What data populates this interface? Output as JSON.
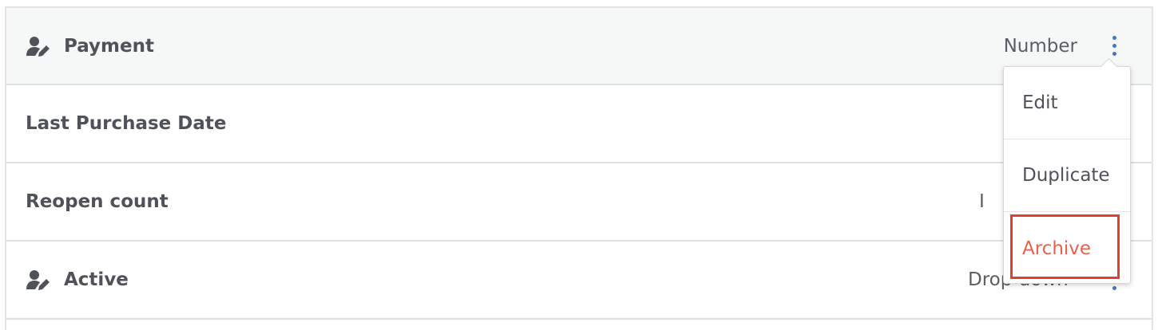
{
  "rows": [
    {
      "label": "Payment",
      "type": "Number",
      "icon": "user-edit-icon"
    },
    {
      "label": "Last Purchase Date",
      "type": ""
    },
    {
      "label": "Reopen count",
      "type": "I"
    },
    {
      "label": "Active",
      "type": "Drop-down",
      "icon": "user-edit-icon"
    }
  ],
  "menu": {
    "items": [
      {
        "label": "Edit"
      },
      {
        "label": "Duplicate"
      },
      {
        "label": "Archive",
        "color": "#e8604e"
      }
    ]
  },
  "colors": {
    "accent": "#3d78c6",
    "danger": "#e8604e",
    "highlight_box": "#e0412f"
  }
}
